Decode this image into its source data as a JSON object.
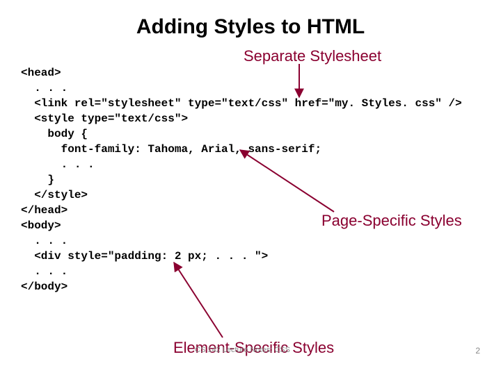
{
  "title": "Adding Styles to HTML",
  "labels": {
    "separate": "Separate Stylesheet",
    "page": "Page-Specific Styles",
    "element": "Element-Specific Styles"
  },
  "code": {
    "l1": "<head>",
    "l2": "  . . .",
    "l3": "  <link rel=\"stylesheet\" type=\"text/css\" href=\"my. Styles. css\" />",
    "l4": "  <style type=\"text/css\">",
    "l5": "    body {",
    "l6": "      font-family: Tahoma, Arial, sans-serif;",
    "l7": "      . . .",
    "l8": "    }",
    "l9": "  </style>",
    "l10": "</head>",
    "l11": "<body>",
    "l12": "  . . .",
    "l13": "  <div style=\"padding: 2 px; . . . \">",
    "l14": "  . . .",
    "l15": "</body>"
  },
  "footer": "CS 142 Lecture Notes: CSS",
  "page_number": "2"
}
